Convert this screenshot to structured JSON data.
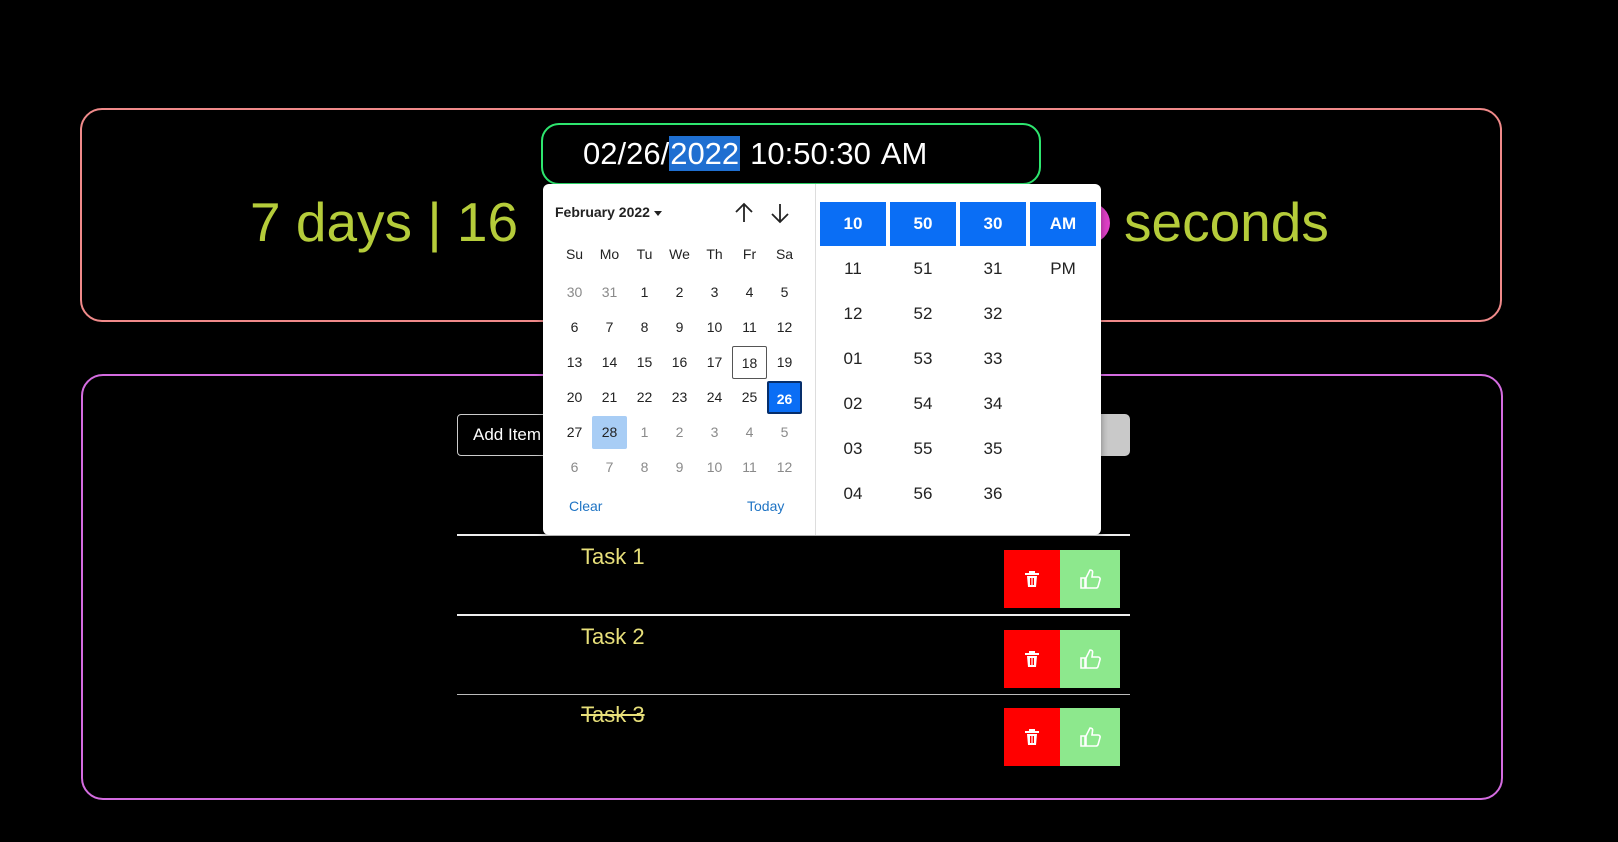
{
  "datetime_input": {
    "date_prefix": "02/26/",
    "year_selected": "2022",
    "time": "10:50:30",
    "ampm": "AM"
  },
  "countdown": {
    "visible_left": "7 days | 16",
    "visible_right": "seconds"
  },
  "calendar": {
    "month_label": "February 2022",
    "weekdays": [
      "Su",
      "Mo",
      "Tu",
      "We",
      "Th",
      "Fr",
      "Sa"
    ],
    "weeks": [
      [
        "30",
        "31",
        "1",
        "2",
        "3",
        "4",
        "5"
      ],
      [
        "6",
        "7",
        "8",
        "9",
        "10",
        "11",
        "12"
      ],
      [
        "13",
        "14",
        "15",
        "16",
        "17",
        "18",
        "19"
      ],
      [
        "20",
        "21",
        "22",
        "23",
        "24",
        "25",
        "26"
      ],
      [
        "27",
        "28",
        "1",
        "2",
        "3",
        "4",
        "5"
      ],
      [
        "6",
        "7",
        "8",
        "9",
        "10",
        "11",
        "12"
      ]
    ],
    "clear_label": "Clear",
    "today_label": "Today"
  },
  "time_picker": {
    "hours": [
      "10",
      "11",
      "12",
      "01",
      "02",
      "03",
      "04"
    ],
    "minutes": [
      "50",
      "51",
      "52",
      "53",
      "54",
      "55",
      "56"
    ],
    "seconds": [
      "30",
      "31",
      "32",
      "33",
      "34",
      "35",
      "36"
    ],
    "periods": [
      "AM",
      "PM"
    ]
  },
  "todo": {
    "input_value": "Add Item",
    "add_button_partial": "m",
    "tasks": [
      {
        "label": "Task 1",
        "done": false
      },
      {
        "label": "Task 2",
        "done": false
      },
      {
        "label": "Task 3",
        "done": true
      }
    ]
  },
  "icons": {
    "delete": "trash-icon",
    "complete": "thumbs-up-icon",
    "nav_up": "arrow-up-icon",
    "nav_down": "arrow-down-icon"
  },
  "colors": {
    "accent_blue": "#0a6ef5",
    "countdown_text": "#b5cc3a",
    "task_text": "#e8e07a",
    "delete_red": "#ff0000",
    "complete_green": "#8de88d"
  }
}
